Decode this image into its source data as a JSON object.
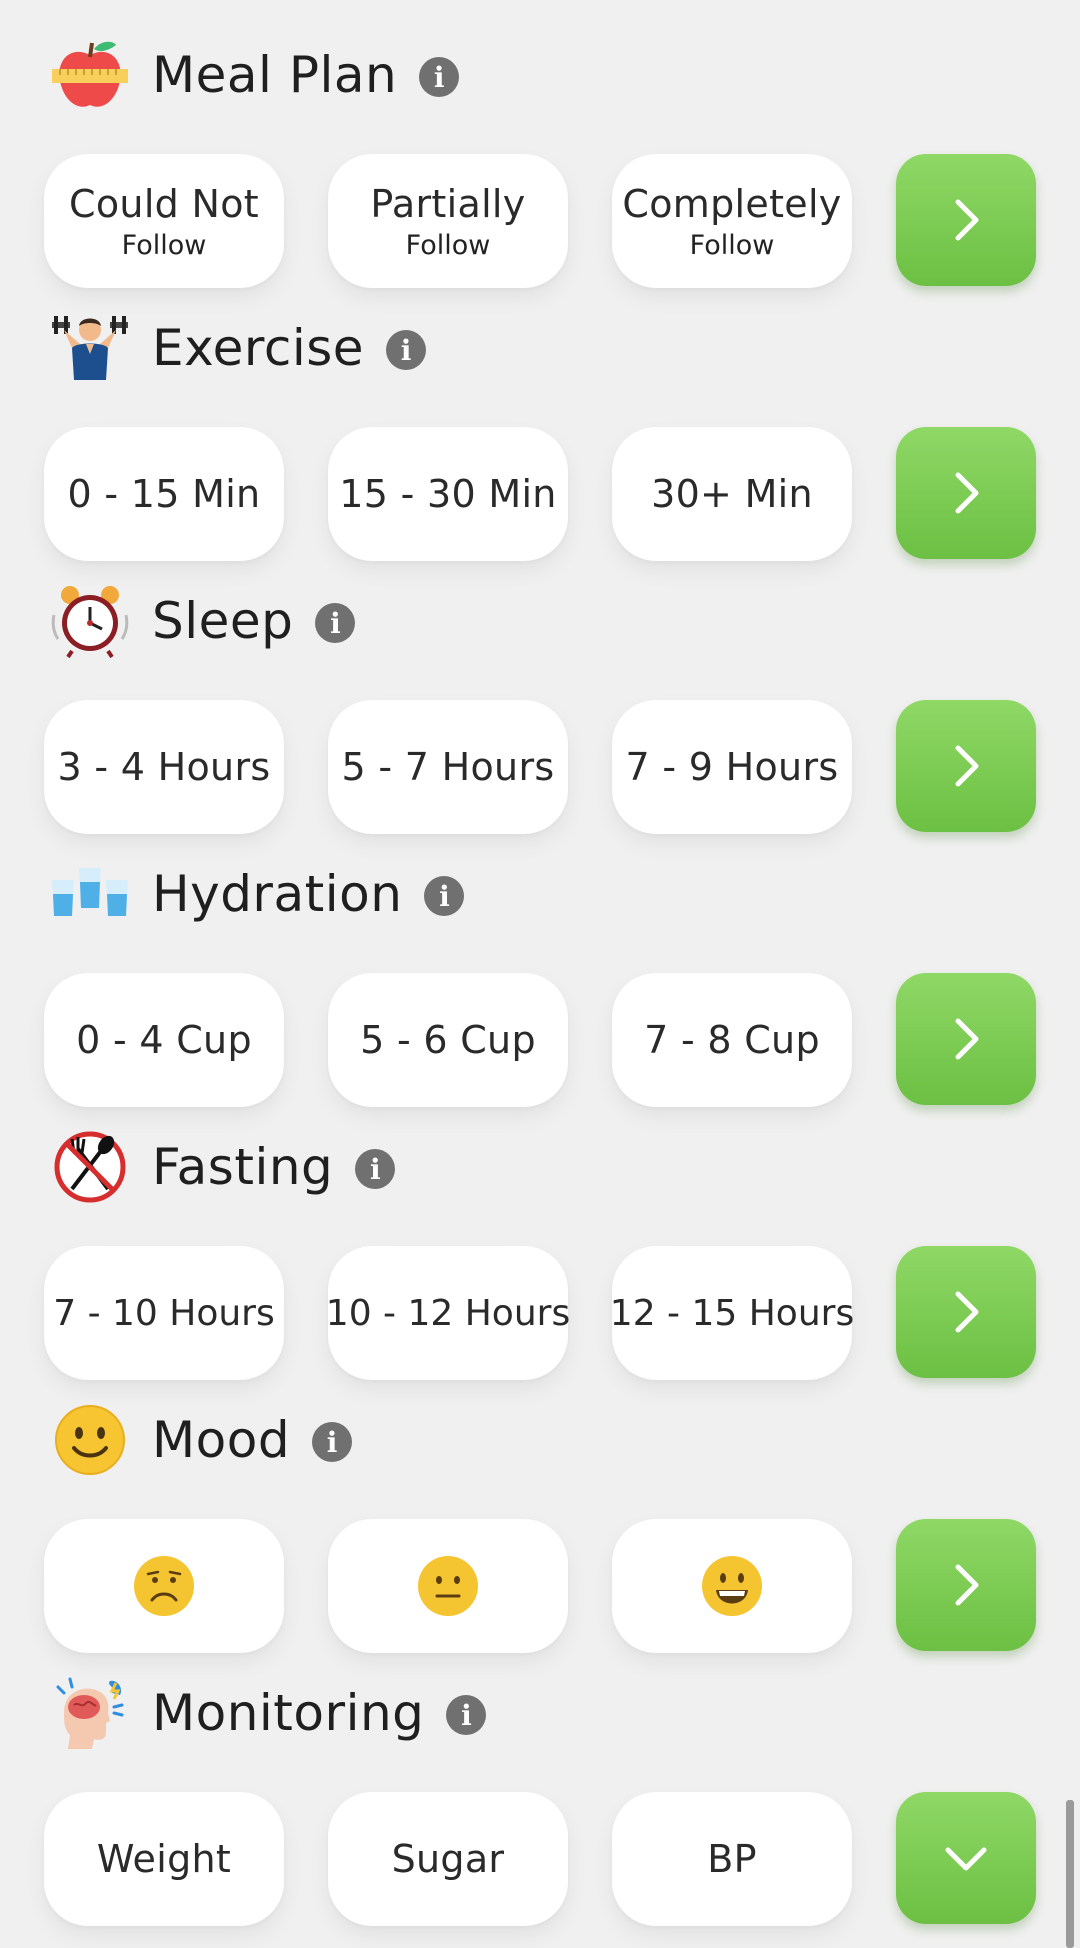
{
  "sections": [
    {
      "title": "Meal Plan",
      "icon": "apple-measuring-tape-icon",
      "options": [
        {
          "main": "Could Not",
          "sub": "Follow"
        },
        {
          "main": "Partially",
          "sub": "Follow"
        },
        {
          "main": "Completely",
          "sub": "Follow"
        }
      ],
      "action": "chevron-right"
    },
    {
      "title": "Exercise",
      "icon": "dumbbell-man-icon",
      "options": [
        {
          "main": "0 - 15 Min"
        },
        {
          "main": "15 - 30 Min"
        },
        {
          "main": "30+ Min"
        }
      ],
      "action": "chevron-right"
    },
    {
      "title": "Sleep",
      "icon": "alarm-clock-icon",
      "options": [
        {
          "main": "3 - 4 Hours"
        },
        {
          "main": "5 - 7 Hours"
        },
        {
          "main": "7 - 9 Hours"
        }
      ],
      "action": "chevron-right"
    },
    {
      "title": "Hydration",
      "icon": "water-glasses-icon",
      "options": [
        {
          "main": "0 - 4 Cup"
        },
        {
          "main": "5 - 6 Cup"
        },
        {
          "main": "7 - 8 Cup"
        }
      ],
      "action": "chevron-right"
    },
    {
      "title": "Fasting",
      "icon": "no-eating-icon",
      "options": [
        {
          "main": "7 - 10 Hours"
        },
        {
          "main": "10 - 12 Hours"
        },
        {
          "main": "12 - 15 Hours"
        }
      ],
      "action": "chevron-right"
    },
    {
      "title": "Mood",
      "icon": "smiley-face-icon",
      "options": [
        {
          "icon": "sad-face-icon"
        },
        {
          "icon": "neutral-face-icon"
        },
        {
          "icon": "happy-face-icon"
        }
      ],
      "action": "chevron-right"
    },
    {
      "title": "Monitoring",
      "icon": "head-brain-icon",
      "options": [
        {
          "main": "Weight"
        },
        {
          "main": "Sugar"
        },
        {
          "main": "BP"
        }
      ],
      "action": "chevron-down"
    }
  ],
  "colors": {
    "background": "#f0f0f0",
    "card": "#ffffff",
    "accent_green": "#7ccc52",
    "info_gray": "#707070",
    "emoji_yellow": "#f5c431"
  }
}
